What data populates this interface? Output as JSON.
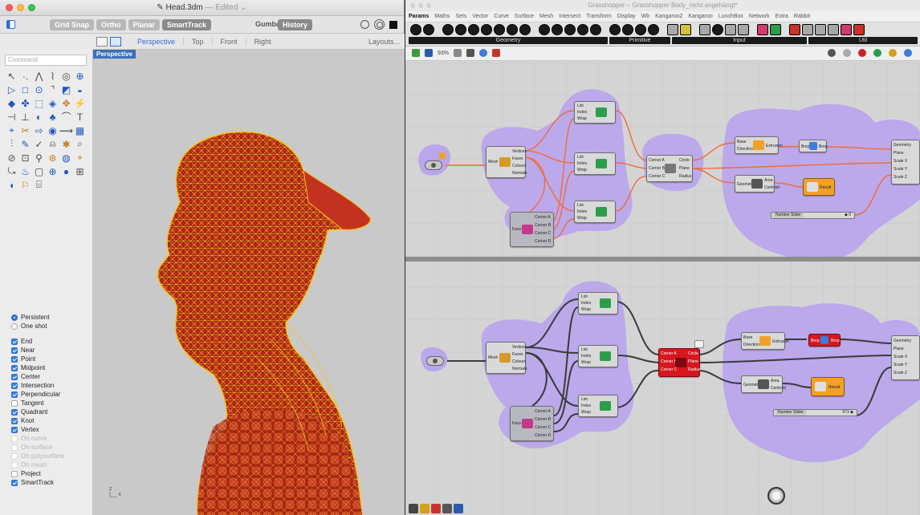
{
  "rhino": {
    "title": "Head.3dm",
    "edited": "— Edited ⌄",
    "osnap_buttons": [
      "Grid Snap",
      "Ortho",
      "Planar",
      "SmartTrack"
    ],
    "gumball": "Gumball",
    "history": "History",
    "viewport_tabs": [
      "Perspective",
      "Top",
      "Front",
      "Right"
    ],
    "layouts": "Layouts...",
    "command_placeholder": "Command",
    "viewport_label": "Perspective",
    "snaps": [
      {
        "label": "Persistent",
        "type": "radio",
        "on": true
      },
      {
        "label": "One shot",
        "type": "radio",
        "on": false
      },
      {
        "label": "End",
        "type": "check",
        "on": true
      },
      {
        "label": "Near",
        "type": "check",
        "on": true
      },
      {
        "label": "Point",
        "type": "check",
        "on": true
      },
      {
        "label": "Midpoint",
        "type": "check",
        "on": true
      },
      {
        "label": "Center",
        "type": "check",
        "on": true
      },
      {
        "label": "Intersection",
        "type": "check",
        "on": true
      },
      {
        "label": "Perpendicular",
        "type": "check",
        "on": true
      },
      {
        "label": "Tangent",
        "type": "check",
        "on": false
      },
      {
        "label": "Quadrant",
        "type": "check",
        "on": true
      },
      {
        "label": "Knot",
        "type": "check",
        "on": true
      },
      {
        "label": "Vertex",
        "type": "check",
        "on": true
      },
      {
        "label": "On curve",
        "type": "check",
        "on": false,
        "dim": true
      },
      {
        "label": "On surface",
        "type": "check",
        "on": false,
        "dim": true
      },
      {
        "label": "On polysurface",
        "type": "check",
        "on": false,
        "dim": true
      },
      {
        "label": "On mesh",
        "type": "check",
        "on": false,
        "dim": true
      },
      {
        "label": "Project",
        "type": "check",
        "on": false
      },
      {
        "label": "SmartTrack",
        "type": "check",
        "on": true
      }
    ],
    "colors": {
      "accent": "#2a6fd6",
      "mesh_fill": "#b8261a",
      "mesh_wire": "#f4c21a"
    }
  },
  "gh": {
    "title": "Grasshopper – Grasshopper Body_nicht angehängt*",
    "menu": [
      "Params",
      "Maths",
      "Sets",
      "Vector",
      "Curve",
      "Surface",
      "Mesh",
      "Intersect",
      "Transform",
      "Display",
      "Wb",
      "Kangaroo2",
      "Kangaroo",
      "LunchBox",
      "Network",
      "Extra",
      "Rabbit"
    ],
    "ribbon_groups": [
      "Geometry",
      "Primitive",
      "Input",
      "Util"
    ],
    "zoom": "93%",
    "top": {
      "mesh": {
        "name": "Mesh",
        "outs": [
          "Vertices",
          "Faces",
          "Colours",
          "Normals"
        ]
      },
      "list_a": {
        "ins": [
          "List",
          "Index",
          "Wrap"
        ]
      },
      "list_b": {
        "ins": [
          "List",
          "Index",
          "Wrap"
        ]
      },
      "list_c": {
        "ins": [
          "List",
          "Index",
          "Wrap"
        ]
      },
      "face": {
        "name": "Face",
        "outs": [
          "Corner A",
          "Corner B",
          "Corner C",
          "Corner D"
        ]
      },
      "circle": {
        "ins": [
          "Corner A",
          "Corner B",
          "Corner C"
        ],
        "outs": [
          "Circle",
          "Plane",
          "Radius"
        ]
      },
      "extrude": {
        "ins": [
          "Base",
          "Direction"
        ],
        "label": "Extrusion"
      },
      "area": {
        "ins": [
          "Geometry"
        ],
        "outs": [
          "Area",
          "Centroid"
        ]
      },
      "cap": {
        "label": "Brep",
        "out": "Brep"
      },
      "result": "Result",
      "slider": {
        "label": "Number Slider",
        "value": "◆ 0"
      },
      "scale": {
        "ins": [
          "Geometry",
          "Plane",
          "Scale X",
          "Scale Y",
          "Scale Z"
        ]
      }
    },
    "bottom": {
      "mesh": {
        "name": "Mesh",
        "outs": [
          "Vertices",
          "Faces",
          "Colours",
          "Normals"
        ]
      },
      "face": {
        "name": "Face",
        "outs": [
          "Corner A",
          "Corner B",
          "Corner C",
          "Corner D"
        ]
      },
      "circle": {
        "ins": [
          "Corner A",
          "Corner B",
          "Corner C"
        ],
        "outs": [
          "Circle",
          "Plane",
          "Radius"
        ]
      },
      "extrude": {
        "ins": [
          "Base",
          "Direction"
        ],
        "label": "Extrusion"
      },
      "area": {
        "ins": [
          "Geometry"
        ],
        "outs": [
          "Area",
          "Centroid"
        ]
      },
      "result": "Result",
      "slider": {
        "label": "Number Slider",
        "value": "973 ◆"
      },
      "scale": {
        "ins": [
          "Geometry",
          "Plane",
          "Scale X",
          "Scale Y",
          "Scale Z"
        ]
      }
    },
    "colors": {
      "group": "#b49ef0",
      "wire_top": "#f26b3a",
      "wire_bottom": "#3a3a3a",
      "red_comp": "#d6171e",
      "orange_comp": "#f2a028"
    }
  }
}
